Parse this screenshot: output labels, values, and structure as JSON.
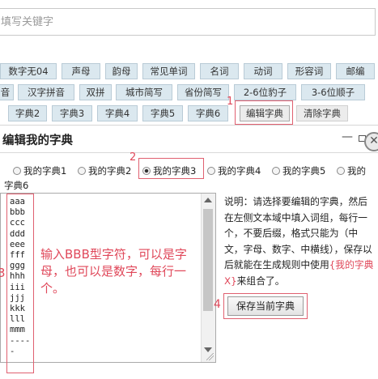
{
  "search": {
    "placeholder": "填写关键字"
  },
  "tag_rows": [
    [
      "数字无04",
      "声母",
      "韵母",
      "常见单词",
      "名词",
      "动词",
      "形容词",
      "邮编"
    ],
    [
      "音",
      "汉字拼音",
      "双拼",
      "城市简写",
      "省份简写",
      "2-6位豹子",
      "3-6位顺子"
    ],
    [
      "字典2",
      "字典3",
      "字典4",
      "字典5",
      "字典6",
      "编辑字典",
      "清除字典"
    ]
  ],
  "annotations": {
    "step1": "1",
    "step2": "2",
    "step3": "3",
    "step4": "4"
  },
  "dialog": {
    "title": "编辑我的字典",
    "min_glyph": "—",
    "close_glyph": "✕",
    "radios": [
      "我的字典1",
      "我的字典2",
      "我的字典3",
      "我的字典4",
      "我的字典5",
      "我的",
      "字典6"
    ],
    "selected_radio": "我的字典3",
    "textarea_lines": [
      "aaa",
      "bbb",
      "ccc",
      "ddd",
      "eee",
      "fff",
      "ggg",
      "hhh",
      "iii",
      "jjj",
      "kkk",
      "lll",
      "mmm",
      "-----"
    ],
    "hint": "输入BBB型字符，可以是字母，也可以是数字，每行一个。",
    "description_pre": "说明：请选择要编辑的字典，然后在左侧文本域中填入词组，每行一个，不要后缀，格式只能为（中文，字母、数字、中横线），保存以后就能在生成规则中使用",
    "description_red": "{我的字典X}",
    "description_post": "来组合了。",
    "save_label": "保存当前字典"
  },
  "colors": {
    "accent_red": "#e0485a",
    "tag_bg": "#dbe8ef"
  }
}
